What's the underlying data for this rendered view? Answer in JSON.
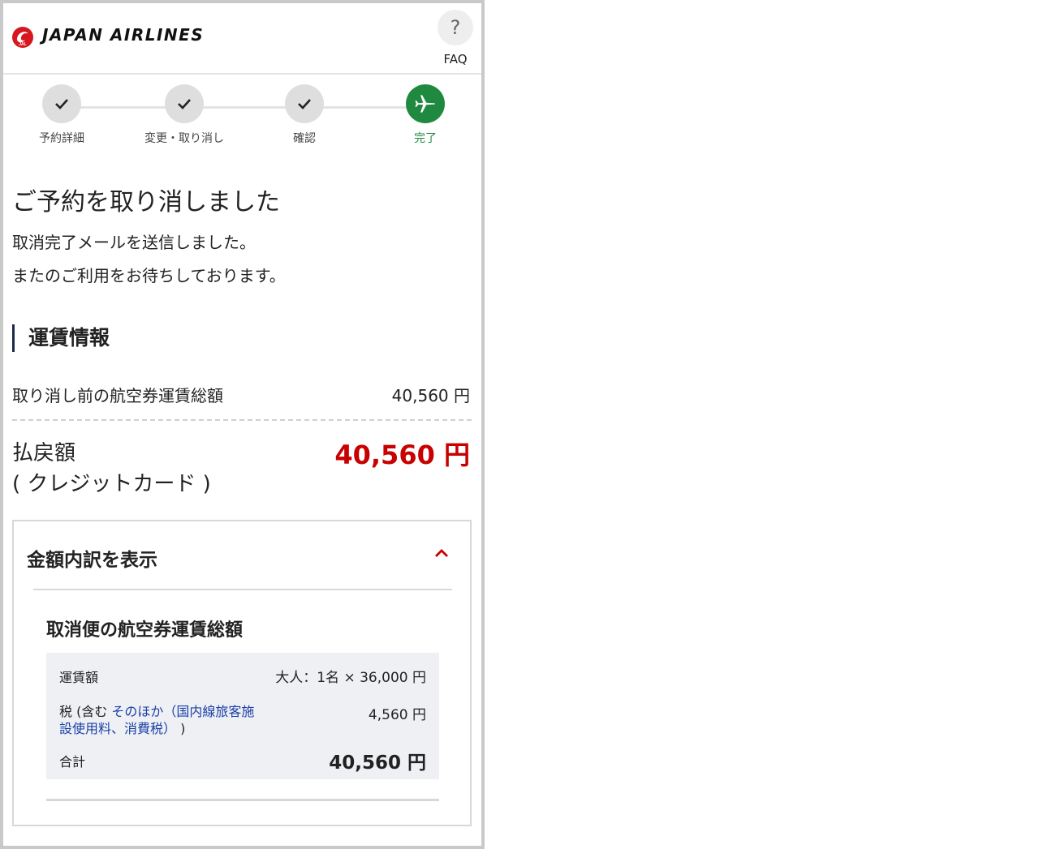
{
  "header": {
    "brand": "JAPAN AIRLINES",
    "logo_mark_text": "JAL",
    "faq_symbol": "?",
    "faq_label": "FAQ"
  },
  "steps": [
    {
      "label": "予約詳細",
      "icon": "check-icon",
      "state": "done"
    },
    {
      "label": "変更・取り消し",
      "icon": "check-icon",
      "state": "done"
    },
    {
      "label": "確認",
      "icon": "check-icon",
      "state": "done"
    },
    {
      "label": "完了",
      "icon": "airplane-icon",
      "state": "current"
    }
  ],
  "main": {
    "title": "ご予約を取り消しました",
    "message_1": "取消完了メールを送信しました。",
    "message_2": "またのご利用をお待ちしております。"
  },
  "fare_info": {
    "heading": "運賃情報",
    "before_label": "取り消し前の航空券運賃総額",
    "before_value": "40,560 円",
    "refund_label_1": "払戻額",
    "refund_label_2": "( クレジットカード )",
    "refund_value": "40,560 円"
  },
  "breakdown": {
    "toggle_label": "金額内訳を表示",
    "chevron_icon": "chevron-up-icon",
    "subtitle": "取消便の航空券運賃総額",
    "fare_label": "運賃額",
    "fare_value": "大人：1名 × 36,000 円",
    "tax_label_prefix": "税 (含む ",
    "tax_link_line1": "そのほか（国内線旅客施",
    "tax_link_line2": "設使用料、消費税）",
    "tax_label_suffix": " )",
    "tax_value": "4,560 円",
    "total_label": "合計",
    "total_value": "40,560 円"
  },
  "colors": {
    "accent_green": "#1f8a3f",
    "refund_red": "#c80000",
    "link_blue": "#1a3fa8",
    "jal_red": "#d7171f"
  }
}
